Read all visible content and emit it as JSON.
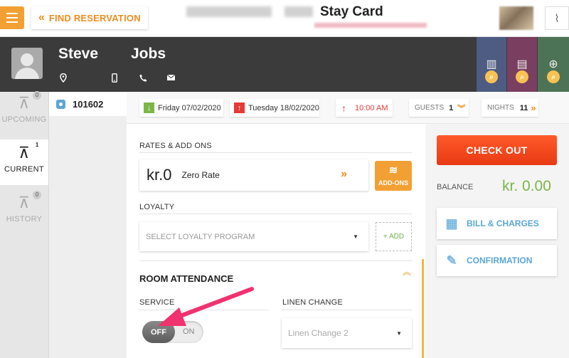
{
  "topbar": {
    "find_reservation": "FIND RESERVATION",
    "title": "Stay Card"
  },
  "guest": {
    "first_name": "Steve",
    "last_name": "Jobs",
    "icons": [
      "location-icon",
      "mobile-icon",
      "phone-icon",
      "email-icon"
    ]
  },
  "nav": {
    "items": [
      {
        "label": "UPCOMING",
        "count": "0"
      },
      {
        "label": "CURRENT",
        "count": "1"
      },
      {
        "label": "HISTORY",
        "count": "0"
      }
    ]
  },
  "room": {
    "number": "101602"
  },
  "dates": {
    "arrival": "Friday 07/02/2020",
    "departure": "Tuesday 18/02/2020",
    "time": "10:00 AM",
    "guests_label": "GUESTS",
    "guests": "1",
    "nights_label": "NIGHTS",
    "nights": "11"
  },
  "rates": {
    "section_label": "RATES & ADD ONS",
    "amount": "kr.0",
    "rate_name": "Zero Rate",
    "addons_label": "ADD-ONS"
  },
  "loyalty": {
    "section_label": "LOYALTY",
    "select_placeholder": "SELECT LOYALTY PROGRAM",
    "add_label": "+ ADD"
  },
  "room_attendance": {
    "title": "ROOM ATTENDANCE",
    "service_label": "SERVICE",
    "toggle_off": "OFF",
    "toggle_on": "ON",
    "service_on": false,
    "linen_label": "LINEN CHANGE",
    "linen_value": "Linen Change 2"
  },
  "summary": {
    "checkout_label": "CHECK OUT",
    "balance_label": "BALANCE",
    "balance_amount": "kr. 0.00",
    "bill_label": "BILL & CHARGES",
    "confirmation_label": "CONFIRMATION"
  },
  "colors": {
    "accent": "#f2a033",
    "checkout": "#f04a1e",
    "balance": "#7bb648",
    "link": "#5aa6d6",
    "header": "#3b3b3b"
  }
}
